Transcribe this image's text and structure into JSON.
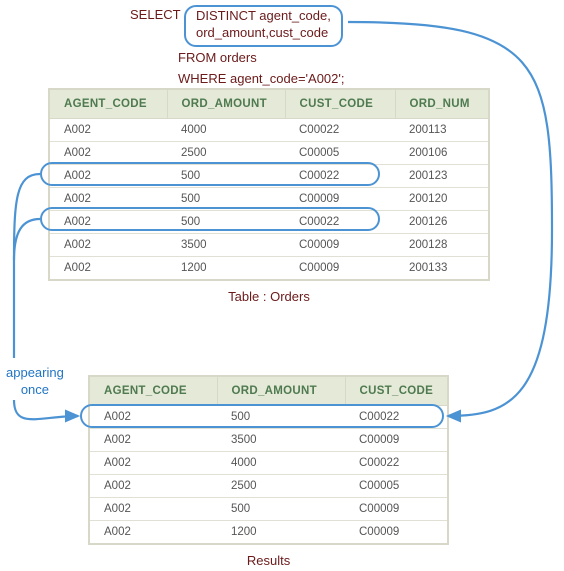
{
  "sql": {
    "select_kw": "SELECT",
    "distinct_phrase_line1": "DISTINCT agent_code,",
    "distinct_phrase_line2": "ord_amount,cust_code",
    "from_line": "FROM orders",
    "where_line": "WHERE agent_code='A002';"
  },
  "orders_table": {
    "headers": [
      "AGENT_CODE",
      "ORD_AMOUNT",
      "CUST_CODE",
      "ORD_NUM"
    ],
    "rows": [
      [
        "A002",
        "4000",
        "C00022",
        "200113"
      ],
      [
        "A002",
        "2500",
        "C00005",
        "200106"
      ],
      [
        "A002",
        "500",
        "C00022",
        "200123"
      ],
      [
        "A002",
        "500",
        "C00009",
        "200120"
      ],
      [
        "A002",
        "500",
        "C00022",
        "200126"
      ],
      [
        "A002",
        "3500",
        "C00009",
        "200128"
      ],
      [
        "A002",
        "1200",
        "C00009",
        "200133"
      ]
    ],
    "caption": "Table : Orders"
  },
  "results_table": {
    "headers": [
      "AGENT_CODE",
      "ORD_AMOUNT",
      "CUST_CODE"
    ],
    "rows": [
      [
        "A002",
        "500",
        "C00022"
      ],
      [
        "A002",
        "3500",
        "C00009"
      ],
      [
        "A002",
        "4000",
        "C00022"
      ],
      [
        "A002",
        "2500",
        "C00005"
      ],
      [
        "A002",
        "500",
        "C00009"
      ],
      [
        "A002",
        "1200",
        "C00009"
      ]
    ],
    "caption": "Results"
  },
  "annotation": {
    "appearing_once": "appearing\nonce"
  },
  "highlight": {
    "orders_duplicate_row_indices": [
      2,
      4
    ],
    "results_merged_row_index": 0
  },
  "arrows": {
    "color": "#4c93d4"
  }
}
